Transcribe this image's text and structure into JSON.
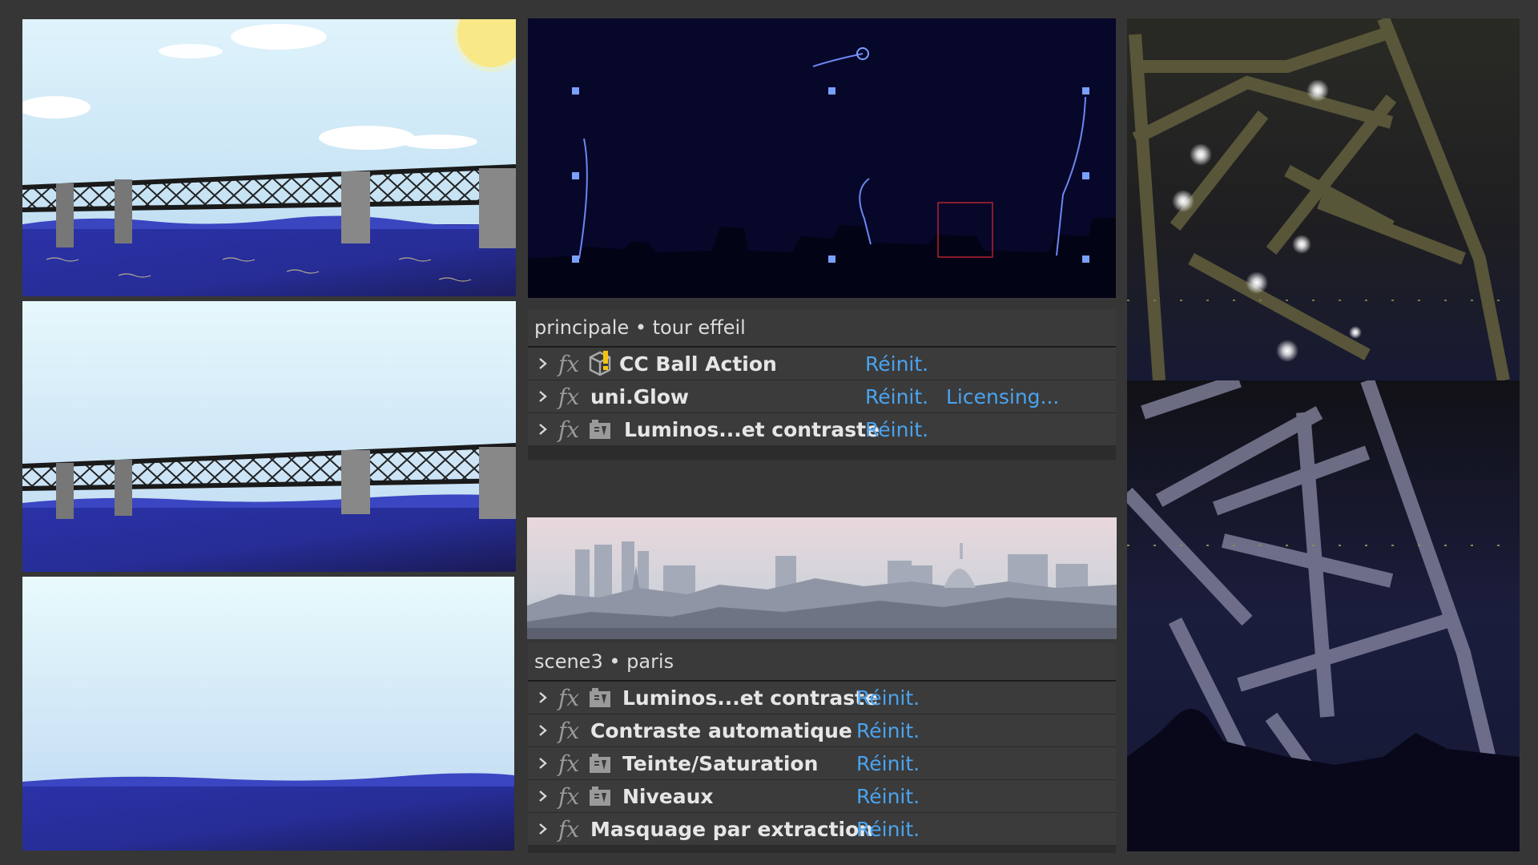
{
  "window": {
    "background": "#363636",
    "accent_link": "#4aa3ef"
  },
  "panels": [
    {
      "title": "principale • tour effeil",
      "effects": [
        {
          "label": "CC Ball Action",
          "icon": "plugin-warning-icon",
          "reset": "Réinit.",
          "extra": ""
        },
        {
          "label": "uni.Glow",
          "icon": "",
          "reset": "Réinit.",
          "extra": "Licensing..."
        },
        {
          "label": "Luminos...et contraste",
          "icon": "preset-effect-icon",
          "reset": "Réinit.",
          "extra": ""
        }
      ]
    },
    {
      "title": "scene3 • paris",
      "effects": [
        {
          "label": "Luminos...et contraste",
          "icon": "preset-effect-icon",
          "reset": "Réinit."
        },
        {
          "label": "Contraste automatique",
          "icon": "",
          "reset": "Réinit."
        },
        {
          "label": "Teinte/Saturation",
          "icon": "preset-effect-icon",
          "reset": "Réinit."
        },
        {
          "label": "Niveaux",
          "icon": "preset-effect-icon",
          "reset": "Réinit."
        },
        {
          "label": "Masquage par extraction",
          "icon": "",
          "reset": "Réinit."
        }
      ]
    }
  ]
}
